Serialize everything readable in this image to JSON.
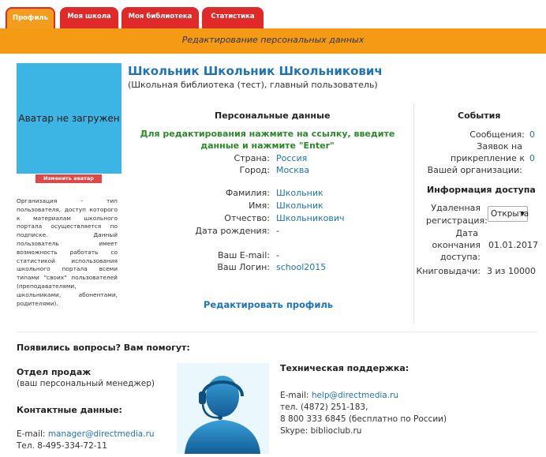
{
  "tabs": [
    {
      "label": "Профиль"
    },
    {
      "label": "Моя школа"
    },
    {
      "label": "Моя библиотека"
    },
    {
      "label": "Статистика"
    }
  ],
  "band_title": "Редактирование персональных данных",
  "avatar": {
    "placeholder": "Аватар не загружен",
    "change_label": "Изменить аватар"
  },
  "org_description": "Организация - тип пользователя, доступ которого к материалам школьного портала осуществляется по подписке. Данный пользователь имеет возможность работать со статистикой использования школьного портала всеми типами \"своих\" пользователей (преподавателями, школьниками, абонентами, родителями).",
  "user": {
    "name": "Школьник Школьник Школьникович",
    "subtitle": "(Школьная библиотека (тест), главный пользователь)"
  },
  "personal": {
    "title": "Персональные данные",
    "hint": "Для редактирования нажмите на ссылку, введите данные и нажмите \"Enter\"",
    "country_label": "Страна:",
    "country": "Россия",
    "city_label": "Город:",
    "city": "Москва",
    "lastname_label": "Фамилия:",
    "lastname": "Школьник",
    "firstname_label": "Имя:",
    "firstname": "Школьник",
    "patronymic_label": "Отчество:",
    "patronymic": "Школьникович",
    "birthdate_label": "Дата рождения:",
    "birthdate": "-",
    "email_label": "Ваш E-mail:",
    "email": "-",
    "login_label": "Ваш Логин:",
    "login": "school2015",
    "edit_link": "Редактировать профиль"
  },
  "events": {
    "title": "События",
    "messages_label": "Сообщения:",
    "messages_count": "0",
    "requests_label_1": "Заявок на",
    "requests_label_2": "прикрепление к",
    "requests_label_3": "Вашей организации:",
    "requests_count": "0"
  },
  "access": {
    "title": "Информация доступа",
    "remote_label_1": "Удаленная",
    "remote_label_2": "регистрация:",
    "remote_value": "Открыта",
    "end_label_1": "Дата",
    "end_label_2": "окончания",
    "end_label_3": "доступа:",
    "end_value": "01.01.2017",
    "loans_label": "Книговыдачи:",
    "loans_value": "3 из 10000"
  },
  "help": {
    "title": "Появились вопросы? Вам помогут:",
    "sales_title": "Отдел продаж",
    "sales_sub": "(ваш персональный менеджер)",
    "contacts_title": "Контактные данные:",
    "email_prefix": "E-mail:",
    "manager_email": "manager@directmedia.ru",
    "manager_phone": "Тел. 8-495-334-72-11",
    "support_title": "Техническая поддержка:",
    "support_email": "help@directmedia.ru",
    "support_phone_1": "тел. (4872) 251-183,",
    "support_phone_2": "8 800 333 6845 (бесплатно по России)",
    "support_skype": "Skype: biblioclub.ru"
  }
}
